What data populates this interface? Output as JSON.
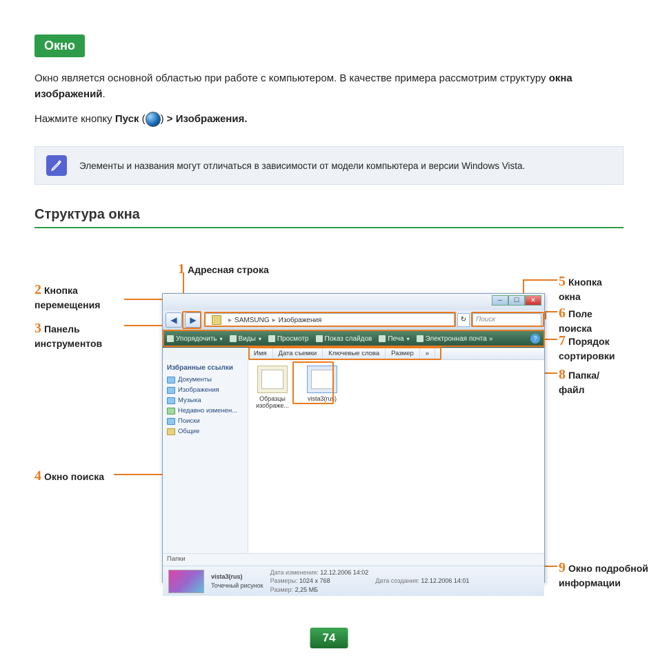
{
  "header_tag": "Окно",
  "intro_before": "Окно является основной областью при работе с компьютером. В качестве примера рассмотрим структуру ",
  "intro_bold": "окна изображений",
  "intro_period": ".",
  "press_prefix": "Нажмите кнопку ",
  "press_start": "Пуск",
  "press_open": " (",
  "press_close": ") ",
  "press_arrow": "> Изображения.",
  "note_text": "Элементы и названия могут отличаться в зависимости от модели компьютера и версии Windows Vista.",
  "section_title": "Структура окна",
  "annotations": {
    "a1": "Адресная строка",
    "a2": "Кнопка перемещения",
    "a3": "Панель инструментов",
    "a4": "Окно поиска",
    "a5": "Кнопка окна",
    "a6": "Поле поиска",
    "a7": "Порядок сортировки",
    "a8": "Папка/файл",
    "a9": "Окно подробной информации"
  },
  "explorer": {
    "title": "Изображения",
    "addr_seg1": "SAMSUNG",
    "addr_seg2": "Изображения",
    "search_placeholder": "Поиск",
    "toolbar": [
      "Упорядочить",
      "Виды",
      "Просмотр",
      "Показ слайдов",
      "Печа",
      "Электронная почта"
    ],
    "columns": [
      "Имя",
      "Дата съемки",
      "Ключевые слова",
      "Размер",
      "»"
    ],
    "sidebar_header": "Избранные ссылки",
    "sidebar_items": [
      "Документы",
      "Изображения",
      "Музыка",
      "Недавно изменен...",
      "Поиски",
      "Общие"
    ],
    "folders_label": "Папки",
    "files": [
      {
        "name": "Образцы изображе..."
      },
      {
        "name": "vista3(rus)"
      }
    ],
    "details": {
      "name": "vista3(rus)",
      "type": "Точечный рисунок",
      "modified_label": "Дата изменения:",
      "modified": "12.12.2006 14:02",
      "dims_label": "Размеры:",
      "dims": "1024 x 768",
      "size_label": "Размер:",
      "size": "2,25 МБ",
      "created_label": "Дата создания:",
      "created": "12.12.2006 14:01"
    }
  },
  "page_number": "74"
}
